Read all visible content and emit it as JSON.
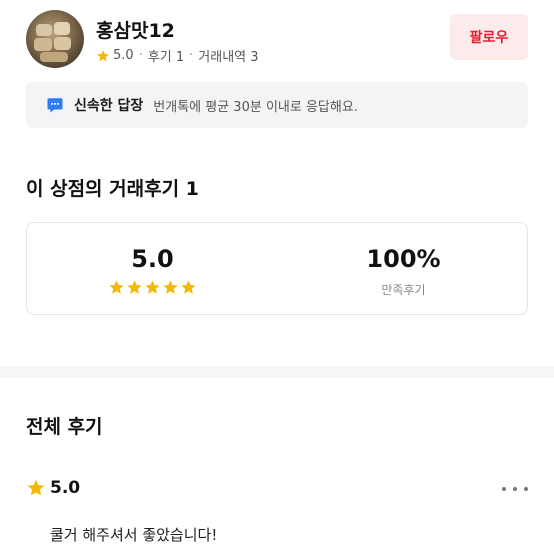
{
  "shop": {
    "name": "홍삼맛12",
    "rating": "5.0",
    "review_count": "후기 1",
    "transactions": "거래내역 3",
    "separator": "·",
    "follow_label": "팔로우"
  },
  "reply_notice": {
    "title": "신속한 답장",
    "description": "번개톡에 평균 30분 이내로 응답해요."
  },
  "reviews_section": {
    "heading": "이 상점의 거래후기 1",
    "average_rating": "5.0",
    "star_count": 5,
    "satisfaction_percent": "100%",
    "satisfaction_label": "만족후기"
  },
  "all_reviews": {
    "heading": "전체 후기",
    "items": [
      {
        "rating": "5.0",
        "text": "쿨거 해주셔서 좋았습니다!"
      }
    ]
  },
  "colors": {
    "accent": "#e3212c",
    "follow_bg": "#fdeaea",
    "star": "#f5b800",
    "chat_icon": "#2f7df6"
  },
  "icons": [
    "star-icon",
    "chat-bubble-icon",
    "more-options-icon"
  ]
}
